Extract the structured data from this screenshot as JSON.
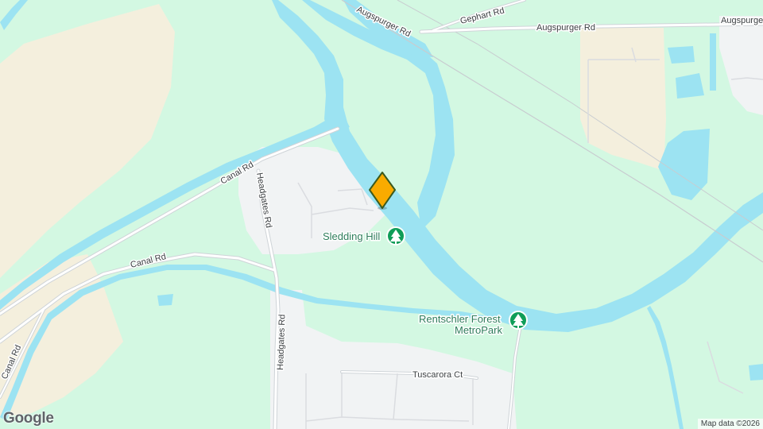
{
  "roads": {
    "augspurger_left": "Augspurger Rd",
    "augspurger_right": "Augspurger Rd",
    "augspurger_far": "Augspurger",
    "gephart": "Gephart Rd",
    "canal_upper": "Canal Rd",
    "canal_lower": "Canal Rd",
    "canal_left": "Canal Rd",
    "headgates_upper": "Headgates Rd",
    "headgates_lower": "Headgates Rd",
    "tuscarora": "Tuscarora Ct"
  },
  "pois": {
    "sledding_hill": {
      "label": "Sledding Hill",
      "icon": "park-tree-icon"
    },
    "rentschler_line1": "Rentschler Forest",
    "rentschler_line2": "MetroPark",
    "rentschler_icon": "park-tree-icon"
  },
  "marker": {
    "icon": "location-pin-icon",
    "color": "#f9ab00"
  },
  "colors": {
    "park": "#d3f8e2",
    "water": "#9ce3f2",
    "urban": "#f1f3f4",
    "farmland": "#f5eedc",
    "road": "#ffffff",
    "road_edge": "#cfd4d8",
    "poi_green": "#0f9d58"
  },
  "footer": {
    "logo": "Google",
    "attribution": "Map data ©2026"
  }
}
